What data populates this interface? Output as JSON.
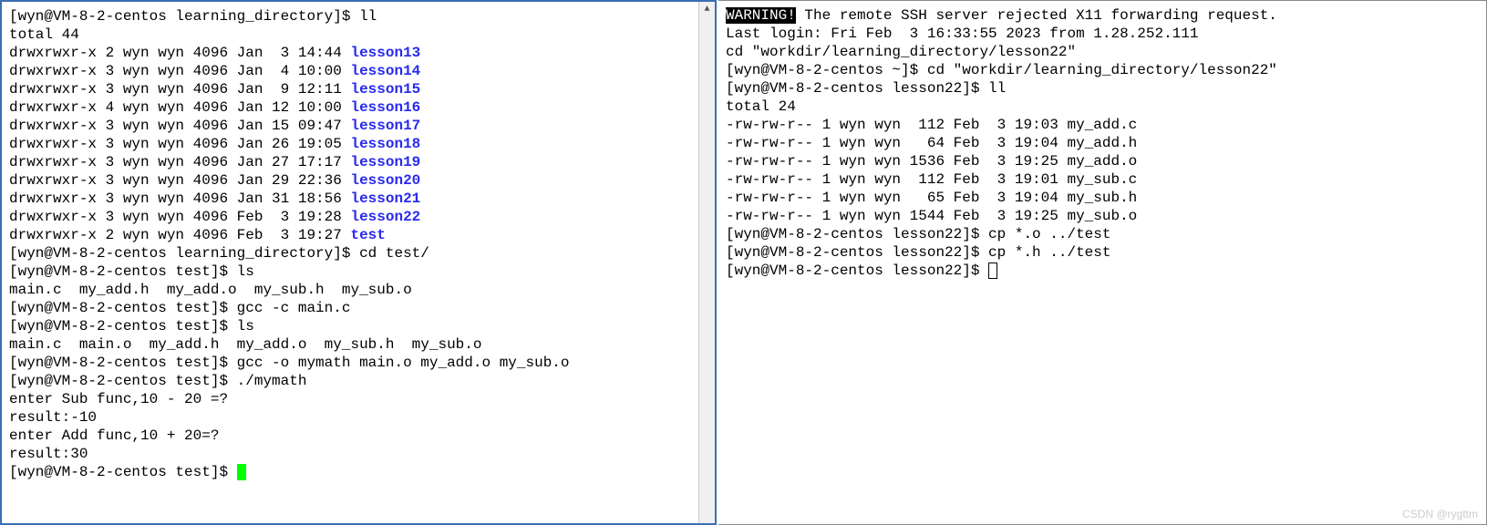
{
  "left": {
    "prompt1": "[wyn@VM-8-2-centos learning_directory]$ ",
    "cmd_ll": "ll",
    "total": "total 44",
    "rows": [
      {
        "perm": "drwxrwxr-x 2 wyn wyn 4096 Jan  3 14:44 ",
        "name": "lesson13"
      },
      {
        "perm": "drwxrwxr-x 3 wyn wyn 4096 Jan  4 10:00 ",
        "name": "lesson14"
      },
      {
        "perm": "drwxrwxr-x 3 wyn wyn 4096 Jan  9 12:11 ",
        "name": "lesson15"
      },
      {
        "perm": "drwxrwxr-x 4 wyn wyn 4096 Jan 12 10:00 ",
        "name": "lesson16"
      },
      {
        "perm": "drwxrwxr-x 3 wyn wyn 4096 Jan 15 09:47 ",
        "name": "lesson17"
      },
      {
        "perm": "drwxrwxr-x 3 wyn wyn 4096 Jan 26 19:05 ",
        "name": "lesson18"
      },
      {
        "perm": "drwxrwxr-x 3 wyn wyn 4096 Jan 27 17:17 ",
        "name": "lesson19"
      },
      {
        "perm": "drwxrwxr-x 3 wyn wyn 4096 Jan 29 22:36 ",
        "name": "lesson20"
      },
      {
        "perm": "drwxrwxr-x 3 wyn wyn 4096 Jan 31 18:56 ",
        "name": "lesson21"
      },
      {
        "perm": "drwxrwxr-x 3 wyn wyn 4096 Feb  3 19:28 ",
        "name": "lesson22"
      },
      {
        "perm": "drwxrwxr-x 2 wyn wyn 4096 Feb  3 19:27 ",
        "name": "test"
      }
    ],
    "cmd_cd": "cd test/",
    "prompt_test": "[wyn@VM-8-2-centos test]$ ",
    "cmd_ls1": "ls",
    "ls1_out": "main.c  my_add.h  my_add.o  my_sub.h  my_sub.o",
    "cmd_gcc1": "gcc -c main.c",
    "cmd_ls2": "ls",
    "ls2_out": "main.c  main.o  my_add.h  my_add.o  my_sub.h  my_sub.o",
    "cmd_gcc2": "gcc -o mymath main.o my_add.o my_sub.o",
    "cmd_run": "./mymath",
    "run_out1": "enter Sub func,10 - 20 =?",
    "run_out2": "result:-10",
    "run_out3": "enter Add func,10 + 20=?",
    "run_out4": "result:30"
  },
  "right": {
    "warning_label": "WARNING!",
    "warning_rest": " The remote SSH server rejected X11 forwarding request.",
    "last_login": "Last login: Fri Feb  3 16:33:55 2023 from 1.28.252.111",
    "echo_cd": "cd \"workdir/learning_directory/lesson22\"",
    "prompt_home": "[wyn@VM-8-2-centos ~]$ ",
    "cmd_cd": "cd \"workdir/learning_directory/lesson22\"",
    "prompt_lesson": "[wyn@VM-8-2-centos lesson22]$ ",
    "cmd_ll": "ll",
    "total": "total 24",
    "rows": [
      "-rw-rw-r-- 1 wyn wyn  112 Feb  3 19:03 my_add.c",
      "-rw-rw-r-- 1 wyn wyn   64 Feb  3 19:04 my_add.h",
      "-rw-rw-r-- 1 wyn wyn 1536 Feb  3 19:25 my_add.o",
      "-rw-rw-r-- 1 wyn wyn  112 Feb  3 19:01 my_sub.c",
      "-rw-rw-r-- 1 wyn wyn   65 Feb  3 19:04 my_sub.h",
      "-rw-rw-r-- 1 wyn wyn 1544 Feb  3 19:25 my_sub.o"
    ],
    "cmd_cp_o": "cp *.o ../test",
    "cmd_cp_h": "cp *.h ../test"
  },
  "watermark": "CSDN @rygttm"
}
